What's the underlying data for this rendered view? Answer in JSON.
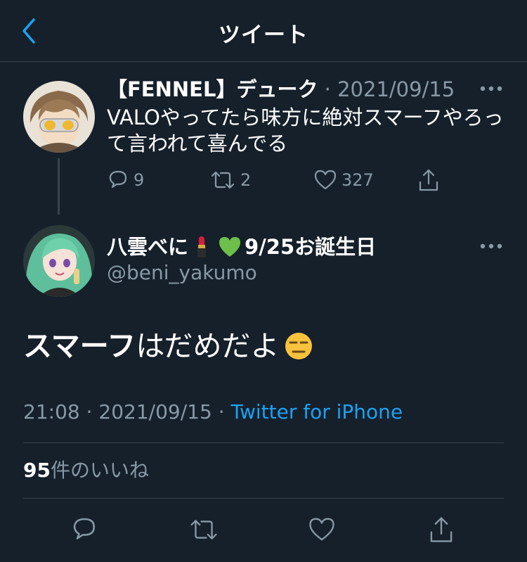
{
  "header": {
    "title": "ツイート",
    "back_icon": "chevron-left-icon",
    "accent": "#1da1f2"
  },
  "parent_tweet": {
    "name": "【FENNEL】デューク",
    "separator": "·",
    "date": "2021/09/15",
    "text": "VALOやってたら味方に絶対スマーフやろって言われて喜んでる",
    "replies": "9",
    "retweets": "2",
    "likes": "327"
  },
  "main_tweet": {
    "name_prefix": "八雲べに",
    "name_suffix": "9/25お誕生日",
    "name_emojis": [
      "lipstick",
      "green-heart"
    ],
    "handle": "@beni_yakumo",
    "text_bold": "スマーフ",
    "text_rest": "はだめだよ",
    "text_emoji": "expressionless-face",
    "time": "21:08",
    "sep1": " · ",
    "date": "2021/09/15",
    "sep2": " · ",
    "source": "Twitter for iPhone",
    "like_count": "95",
    "like_label": "件のいいね"
  },
  "colors": {
    "background": "#15202b",
    "muted": "#8899a6",
    "border": "#38444d",
    "link": "#1da1f2"
  }
}
